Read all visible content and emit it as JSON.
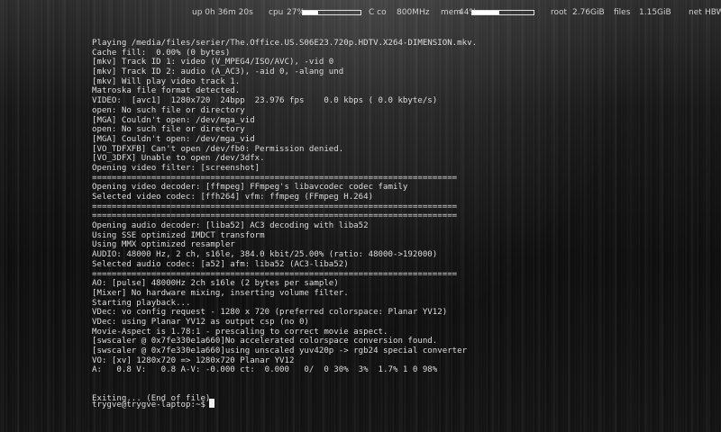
{
  "statusbar": {
    "uptime": "up 0h 36m 20s",
    "cpu_label": "cpu",
    "cpu_value": "27%",
    "cpu_percent": 27,
    "freq_label": "C co",
    "freq_value": "800MHz",
    "mem_label": "mem",
    "mem_value": "44%",
    "mem_percent": 44,
    "root_label": "root",
    "root_value": "2.76GiB",
    "files_label": "files",
    "files_value": "1.15GiB",
    "net_label": "net",
    "net_value": "HBW"
  },
  "terminal": {
    "lines": [
      "Playing /media/files/serier/The.Office.US.S06E23.720p.HDTV.X264-DIMENSION.mkv.",
      "Cache fill:  0.00% (0 bytes)",
      "[mkv] Track ID 1: video (V_MPEG4/ISO/AVC), -vid 0",
      "[mkv] Track ID 2: audio (A_AC3), -aid 0, -alang und",
      "[mkv] Will play video track 1.",
      "Matroska file format detected.",
      "VIDEO:  [avc1]  1280x720  24bpp  23.976 fps    0.0 kbps ( 0.0 kbyte/s)",
      "open: No such file or directory",
      "[MGA] Couldn't open: /dev/mga_vid",
      "open: No such file or directory",
      "[MGA] Couldn't open: /dev/mga_vid",
      "[VO_TDFXFB] Can't open /dev/fb0: Permission denied.",
      "[VO_3DFX] Unable to open /dev/3dfx.",
      "Opening video filter: [screenshot]",
      "==========================================================================",
      "Opening video decoder: [ffmpeg] FFmpeg's libavcodec codec family",
      "Selected video codec: [ffh264] vfm: ffmpeg (FFmpeg H.264)",
      "==========================================================================",
      "==========================================================================",
      "Opening audio decoder: [liba52] AC3 decoding with liba52",
      "Using SSE optimized IMDCT transform",
      "Using MMX optimized resampler",
      "AUDIO: 48000 Hz, 2 ch, s16le, 384.0 kbit/25.00% (ratio: 48000->192000)",
      "Selected audio codec: [a52] afm: liba52 (AC3-liba52)",
      "==========================================================================",
      "AO: [pulse] 48000Hz 2ch s16le (2 bytes per sample)",
      "[Mixer] No hardware mixing, inserting volume filter.",
      "Starting playback...",
      "VDec: vo config request - 1280 x 720 (preferred colorspace: Planar YV12)",
      "VDec: using Planar YV12 as output csp (no 0)",
      "Movie-Aspect is 1.78:1 - prescaling to correct movie aspect.",
      "[swscaler @ 0x7fe330e1a660]No accelerated colorspace conversion found.",
      "[swscaler @ 0x7fe330e1a660]using unscaled yuv420p -> rgb24 special converter",
      "VO: [xv] 1280x720 => 1280x720 Planar YV12",
      "A:   0.8 V:   0.8 A-V: -0.000 ct:  0.000   0/  0 30%  3%  1.7% 1 0 98%",
      "",
      "",
      "Exiting... (End of file)"
    ],
    "prompt": "trygve@trygve-laptop:~$"
  }
}
